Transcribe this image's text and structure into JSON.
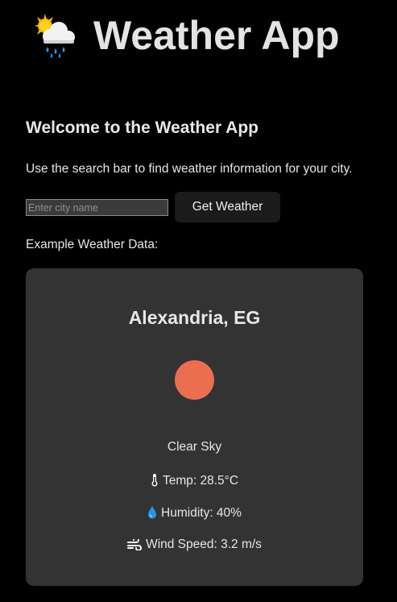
{
  "header": {
    "title": "Weather App",
    "logo_icon": "sun-behind-rain-cloud-icon"
  },
  "welcome": {
    "heading": "Welcome to the Weather App",
    "intro": "Use the search bar to find weather information for your city."
  },
  "search": {
    "placeholder": "Enter city name",
    "value": "",
    "button_label": "Get Weather"
  },
  "example": {
    "label": "Example Weather Data:",
    "city": "Alexandria, EG",
    "condition_icon": "sun-icon",
    "condition": "Clear Sky",
    "temp_icon": "thermometer-icon",
    "temp": "Temp: 28.5°C",
    "humidity_icon": "droplet-icon",
    "humidity": "Humidity: 40%",
    "wind_icon": "wind-icon",
    "wind": "Wind Speed: 3.2 m/s"
  },
  "colors": {
    "background": "#000000",
    "card": "#333333",
    "sun": "#ea6e4f",
    "button": "#1b1b1b",
    "text": "#e6e6e6"
  }
}
